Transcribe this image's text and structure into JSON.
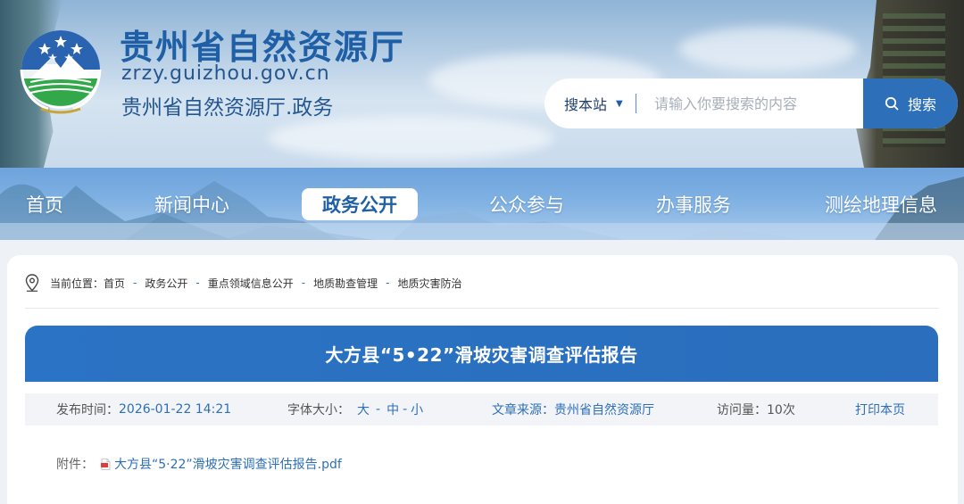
{
  "header": {
    "title": "贵州省自然资源厅",
    "domain": "zrzy.guizhou.gov.cn",
    "subtitle": "贵州省自然资源厅.政务"
  },
  "search": {
    "scope_label": "搜本站",
    "placeholder": "请输入你要搜索的内容",
    "button_label": "搜索"
  },
  "nav": {
    "items": [
      {
        "label": "首页"
      },
      {
        "label": "新闻中心"
      },
      {
        "label": "政务公开",
        "active": true
      },
      {
        "label": "公众参与"
      },
      {
        "label": "办事服务"
      },
      {
        "label": "测绘地理信息"
      }
    ]
  },
  "breadcrumb": {
    "prefix": "当前位置：",
    "items": [
      "首页",
      "政务公开",
      "重点领域信息公开",
      "地质勘查管理",
      "地质灾害防治"
    ],
    "separator": "-"
  },
  "article": {
    "title": "大方县“5•22”滑坡灾害调查评估报告",
    "meta": {
      "publish_label": "发布时间：",
      "publish_time": "2026-01-22 14:21",
      "font_size_label": "字体大小：",
      "font_sizes": [
        "大",
        "中",
        "小"
      ],
      "source_label": "文章来源：",
      "source": "贵州省自然资源厅",
      "views_label": "访问量：",
      "views": "10次",
      "print_label": "打印本页"
    },
    "attachment": {
      "label": "附件：",
      "file_name": "大方县“5·22”滑坡灾害调查评估报告.pdf"
    }
  },
  "colors": {
    "primary": "#2d6fb8",
    "title_blue": "#1f5fa6",
    "nav_bg": "#7fb1e3"
  }
}
